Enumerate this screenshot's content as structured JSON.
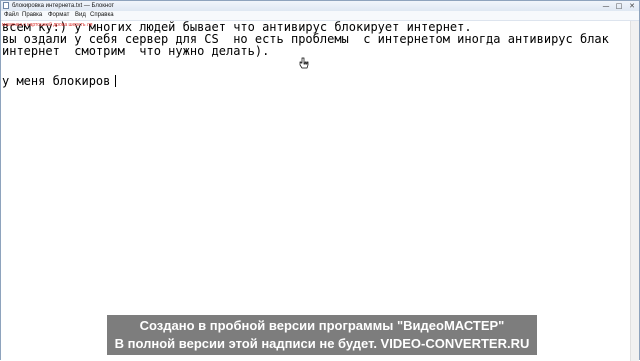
{
  "window": {
    "title": "блокировка интернета.txt — Блокнот"
  },
  "window_controls": {
    "minimize": "—",
    "maximize": "□",
    "close": "✕"
  },
  "menu": {
    "items": [
      "Файл",
      "Правка",
      "Формат",
      "Вид",
      "Справка"
    ]
  },
  "editor": {
    "overlay_text": "мамочка с картошкой дрова шерсть ля",
    "lines": [
      "всем ку:) у многих людей бывает что антивирус блокирует интернет.",
      "вы оздали у себя сервер для CS  но есть проблемы  с интернетом иногда антивирус блак",
      "интернет  смотрим  что нужно делать).",
      "",
      "у меня блокиров"
    ]
  },
  "watermark": {
    "line1": "Создано в пробной версии программы \"ВидеоМАСТЕР\"",
    "line2": "В полной версии этой надписи не будет. VIDEO-CONVERTER.RU"
  },
  "colors": {
    "overlay_text": "#d9302c",
    "watermark_bg": "#7d7d7d",
    "watermark_text": "#ffffff"
  }
}
